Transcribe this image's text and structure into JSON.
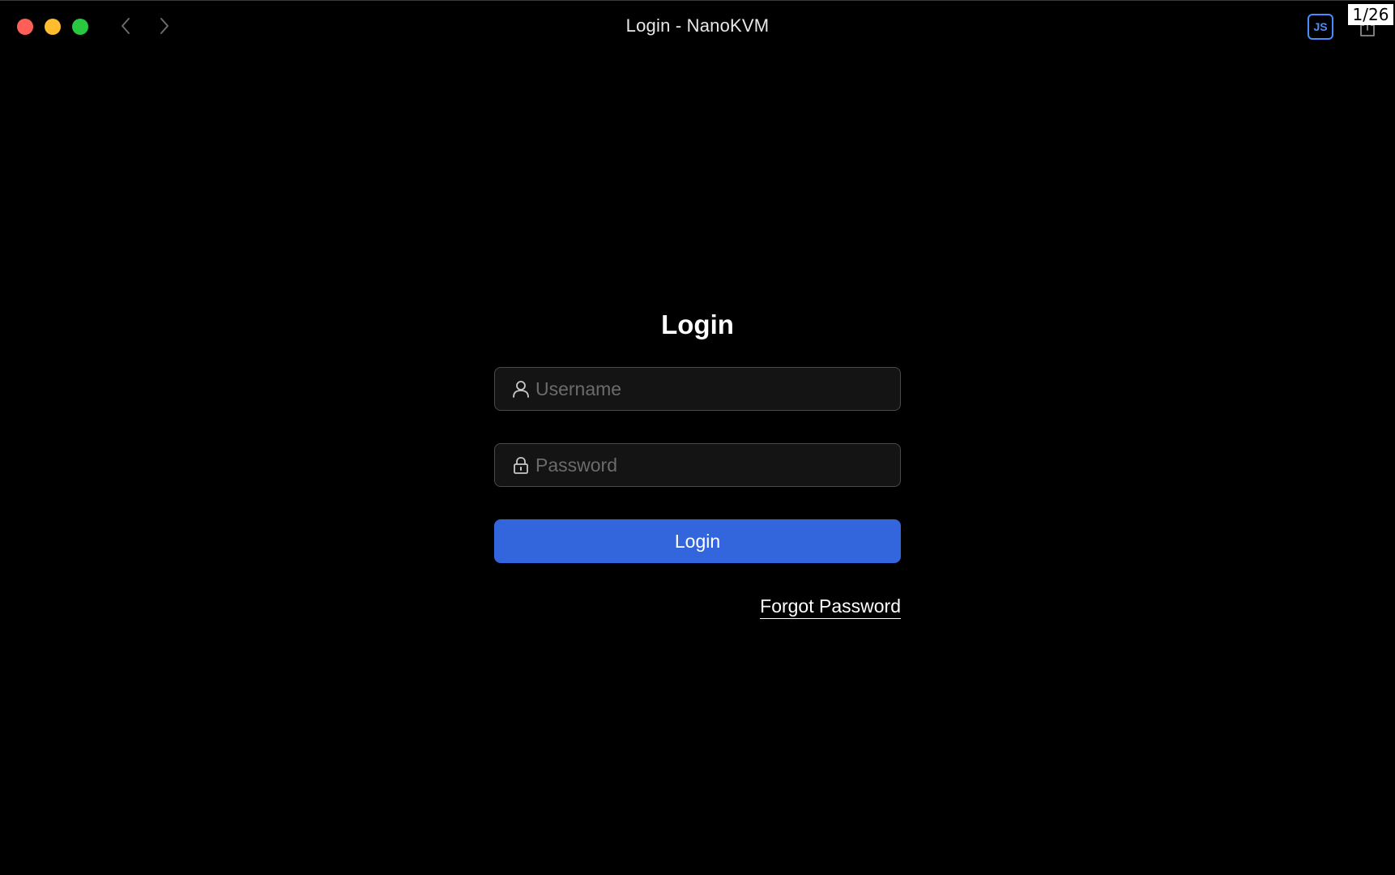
{
  "window": {
    "title": "Login - NanoKVM",
    "page_counter": "1/26",
    "extension_label": "JS"
  },
  "login": {
    "heading": "Login",
    "username_placeholder": "Username",
    "password_placeholder": "Password",
    "submit_label": "Login",
    "forgot_password_label": "Forgot Password"
  },
  "icons": {
    "back": "chevron-left-icon",
    "forward": "chevron-right-icon",
    "share": "share-icon",
    "username": "user-icon",
    "password": "lock-icon"
  },
  "colors": {
    "background": "#000000",
    "accent": "#3366dd",
    "field_border": "#4a4a4a",
    "traffic_close": "#ff5f57",
    "traffic_minimize": "#febc2e",
    "traffic_maximize": "#28c840",
    "extension_blue": "#4a8cff"
  }
}
